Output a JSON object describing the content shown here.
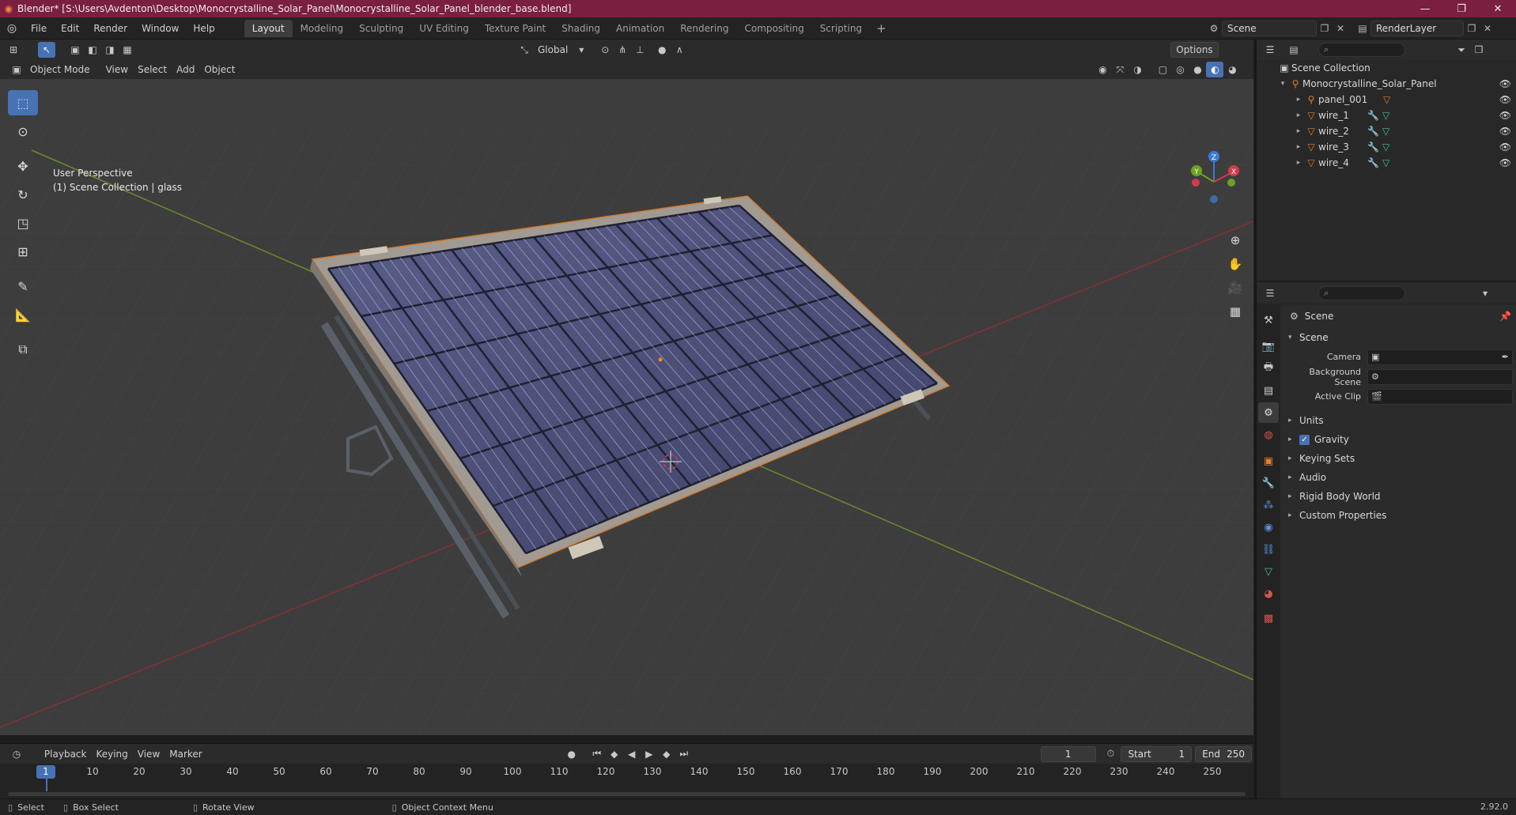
{
  "window": {
    "title": "Blender* [S:\\Users\\Avdenton\\Desktop\\Monocrystalline_Solar_Panel\\Monocrystalline_Solar_Panel_blender_base.blend]",
    "minimize": "—",
    "maximize": "❐",
    "close": "✕"
  },
  "menu": [
    "File",
    "Edit",
    "Render",
    "Window",
    "Help"
  ],
  "workspaces": [
    "Layout",
    "Modeling",
    "Sculpting",
    "UV Editing",
    "Texture Paint",
    "Shading",
    "Animation",
    "Rendering",
    "Compositing",
    "Scripting"
  ],
  "active_workspace": "Layout",
  "scene_selector": "Scene",
  "render_layer": "RenderLayer",
  "viewport_header": {
    "transform_orientation": "Global",
    "options": "Options",
    "mode": "Object Mode",
    "menus": [
      "View",
      "Select",
      "Add",
      "Object"
    ]
  },
  "viewport": {
    "perspective": "User Perspective",
    "collection_info": "(1) Scene Collection | glass"
  },
  "gizmo": {
    "z": "Z",
    "y": "Y",
    "x": "X"
  },
  "outliner": {
    "search_placeholder": "",
    "root": "Scene Collection",
    "collection": "Monocrystalline_Solar_Panel",
    "items": [
      "panel_001",
      "wire_1",
      "wire_2",
      "wire_3",
      "wire_4"
    ]
  },
  "properties": {
    "context_title": "Scene",
    "panel": "Scene",
    "fields": [
      {
        "label": "Camera",
        "value": ""
      },
      {
        "label": "Background Scene",
        "value": ""
      },
      {
        "label": "Active Clip",
        "value": ""
      }
    ],
    "subpanels": [
      "Units",
      "Gravity",
      "Keying Sets",
      "Audio",
      "Rigid Body World",
      "Custom Properties"
    ]
  },
  "timeline": {
    "menus": [
      "Playback",
      "Keying",
      "View",
      "Marker"
    ],
    "current_frame": "1",
    "start_label": "Start",
    "start": "1",
    "end_label": "End",
    "end": "250",
    "ticks": [
      "10",
      "20",
      "30",
      "40",
      "50",
      "60",
      "70",
      "80",
      "90",
      "100",
      "110",
      "120",
      "130",
      "140",
      "150",
      "160",
      "170",
      "180",
      "190",
      "200",
      "210",
      "220",
      "230",
      "240",
      "250"
    ],
    "cursor": "1"
  },
  "statusbar": {
    "select": "Select",
    "box_select": "Box Select",
    "rotate": "Rotate View",
    "context_menu": "Object Context Menu",
    "version": "2.92.0"
  },
  "colors": {
    "accent": "#4772b3",
    "titlebar": "#7a1f3f",
    "object_orange": "#e87d2c",
    "modifier_blue": "#5b8fd6",
    "mesh_green": "#47c28e"
  }
}
